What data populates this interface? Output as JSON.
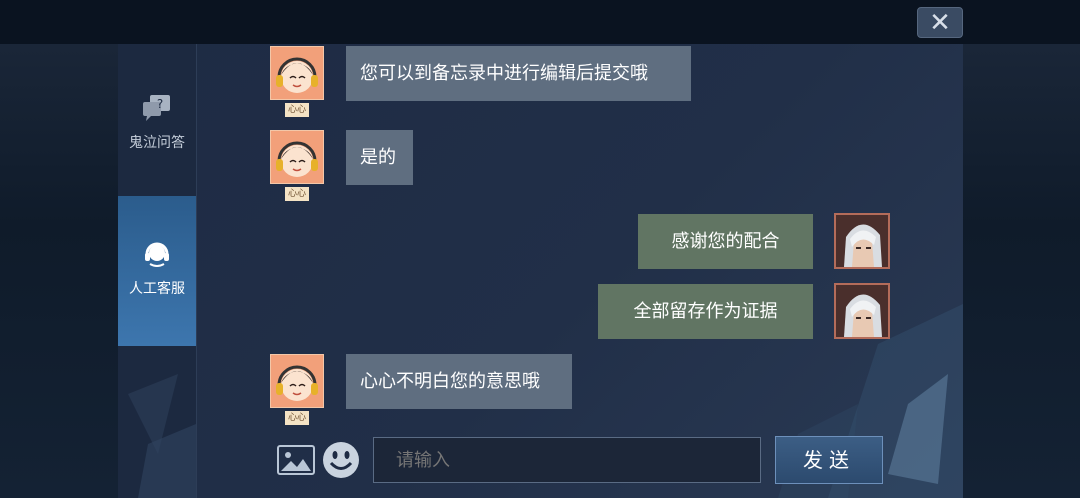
{
  "window": {
    "close_label": "✕"
  },
  "sidebar": {
    "items": [
      {
        "label": "鬼泣问答",
        "icon": "question-bubble-icon",
        "active": false
      },
      {
        "label": "人工客服",
        "icon": "headset-icon",
        "active": true
      }
    ]
  },
  "chat": {
    "agent_tag": "心心",
    "messages": [
      {
        "from": "agent",
        "text": "您可以到备忘录中进行编辑后提交哦"
      },
      {
        "from": "agent",
        "text": "是的"
      },
      {
        "from": "user",
        "text": "感谢您的配合"
      },
      {
        "from": "user",
        "text": "全部留存作为证据"
      },
      {
        "from": "agent",
        "text": "心心不明白您的意思哦"
      }
    ]
  },
  "input": {
    "placeholder": "请输入",
    "send_label": "发送",
    "image_icon": "image-icon",
    "emoji_icon": "emoji-icon"
  },
  "colors": {
    "agent_bubble": "#5f6e80",
    "user_bubble": "#617563",
    "active_tab": "#3d76ae"
  }
}
